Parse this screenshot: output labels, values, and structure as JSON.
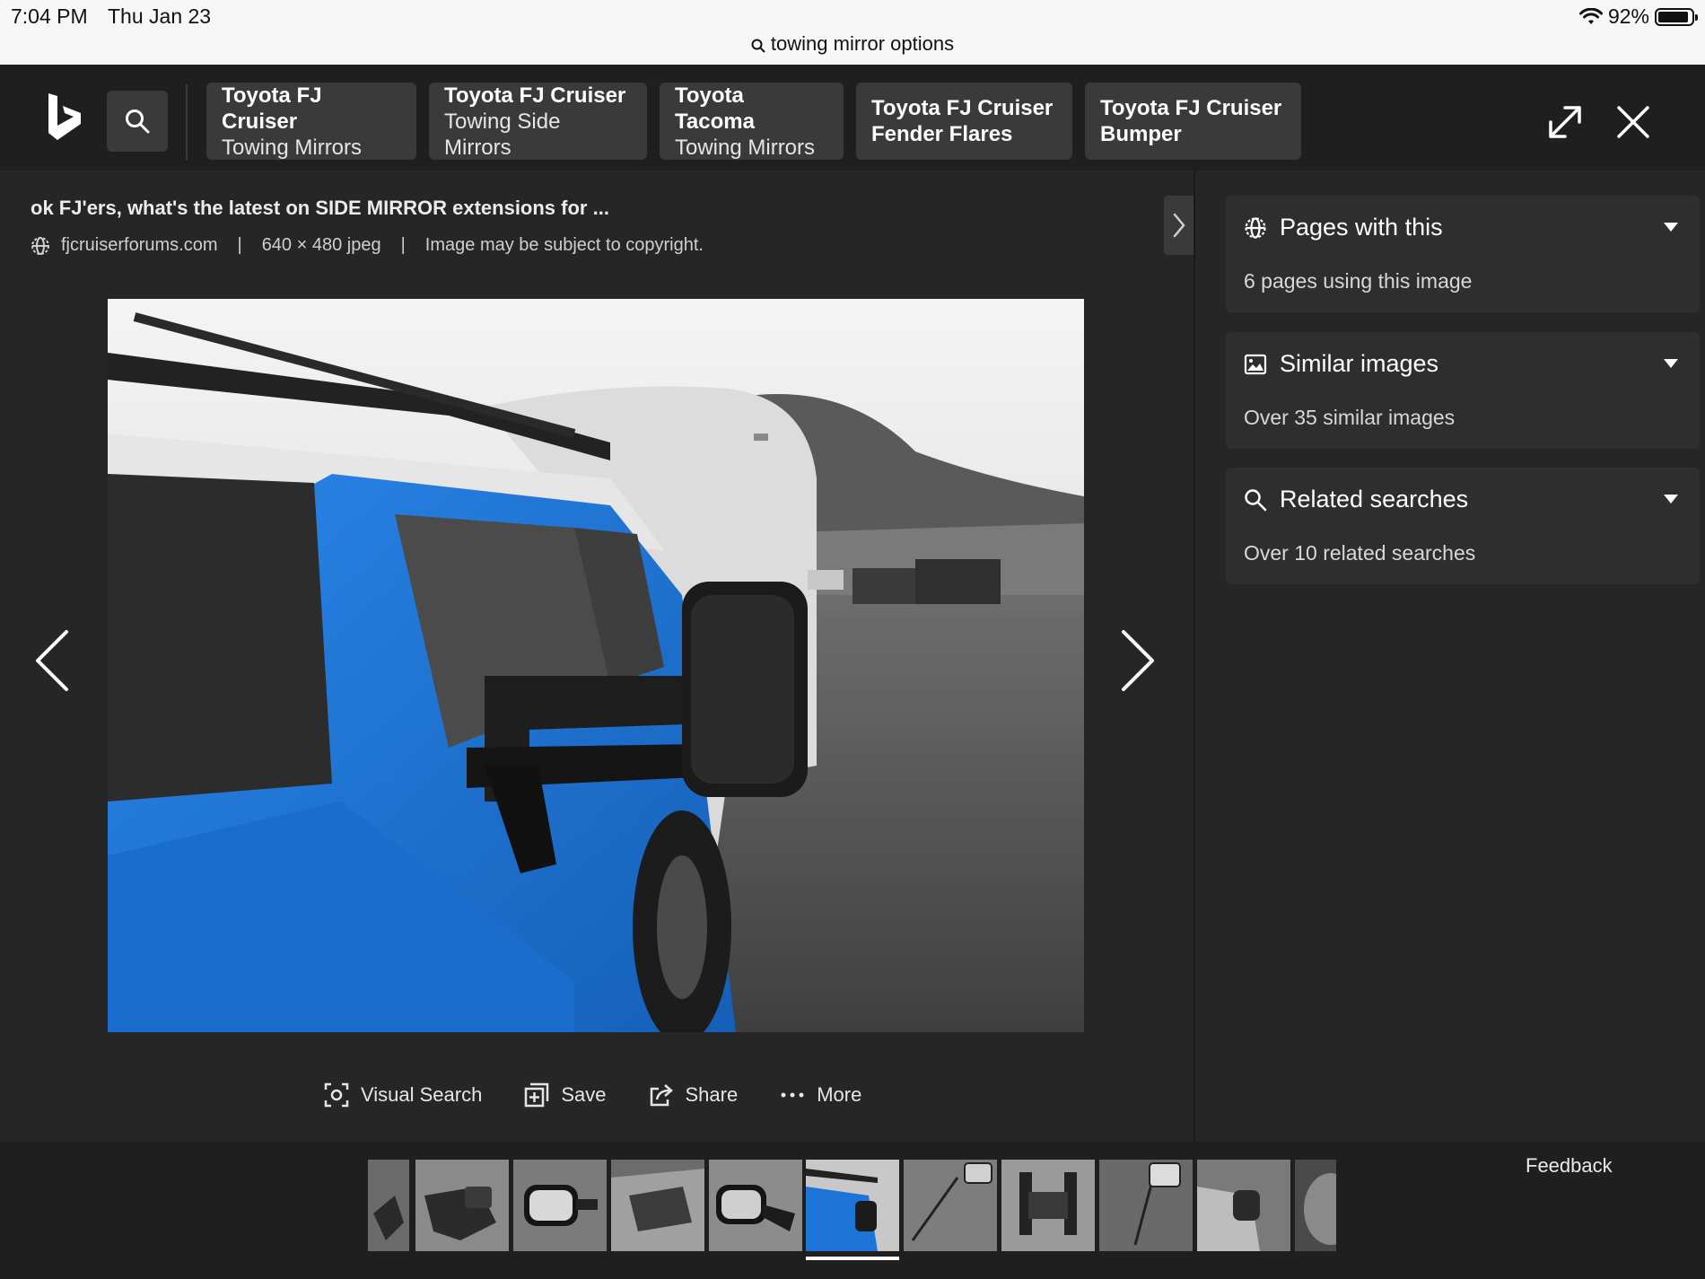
{
  "status_bar": {
    "time": "7:04 PM",
    "date": "Thu Jan 23",
    "battery": "92%",
    "battery_level": 0.92,
    "url": "towing mirror options"
  },
  "header": {
    "chips": [
      {
        "line1": "Toyota FJ Cruiser",
        "line2": "Towing Mirrors"
      },
      {
        "line1": "Toyota FJ Cruiser",
        "line2": "Towing Side Mirrors"
      },
      {
        "line1": "Toyota Tacoma",
        "line2": "Towing Mirrors"
      },
      {
        "line1": "Toyota FJ Cruiser",
        "line2": "Fender Flares"
      },
      {
        "line1": "Toyota FJ Cruiser",
        "line2": "Bumper"
      }
    ]
  },
  "image": {
    "title": "ok FJ'ers, what's the latest on SIDE MIRROR extensions for ...",
    "source": "fjcruiserforums.com",
    "dimensions": "640 × 480 jpeg",
    "copyright": "Image may be subject to copyright.",
    "separator": "|"
  },
  "actions": {
    "visual_search": "Visual Search",
    "save": "Save",
    "share": "Share",
    "more": "More"
  },
  "panel": {
    "pages": {
      "title": "Pages with this",
      "subtitle": "6 pages using this image"
    },
    "similar": {
      "title": "Similar images",
      "subtitle": "Over 35 similar images"
    },
    "related": {
      "title": "Related searches",
      "subtitle": "Over 10 related searches"
    }
  },
  "filmstrip": {
    "feedback": "Feedback"
  },
  "colors": {
    "background": "#262626",
    "header": "#1f1f1f",
    "chip": "#3a3a3a",
    "card": "#2e2e2e",
    "vehicle_blue": "#1e74d6"
  }
}
